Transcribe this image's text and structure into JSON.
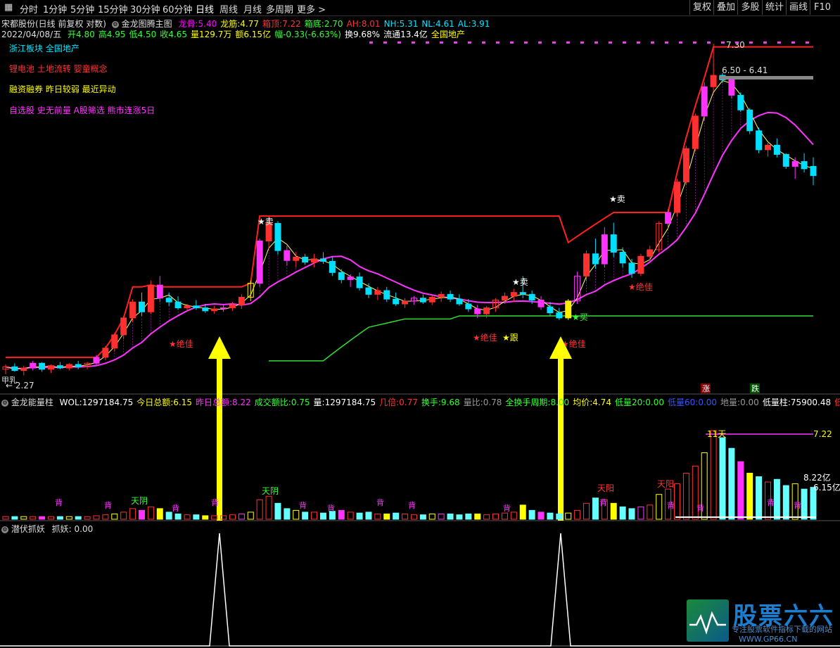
{
  "toolbar": {
    "periods": [
      "分时",
      "1分钟",
      "5分钟",
      "15分钟",
      "30分钟",
      "60分钟",
      "日线",
      "周线",
      "月线",
      "多周期",
      "更多 >"
    ],
    "active": "日线",
    "right_buttons": [
      "复权",
      "叠加",
      "多股",
      "统计",
      "画线",
      "F10"
    ]
  },
  "header": {
    "stock": "宋都股份(日线 前复权 对数)",
    "indicator_name": "金龙图腾主图",
    "stats": [
      {
        "label": "龙骨:",
        "value": "5.40",
        "color": "#ff00ff"
      },
      {
        "label": "龙筋:",
        "value": "4.77",
        "color": "#ffff00"
      },
      {
        "label": "箱顶:",
        "value": "7.22",
        "color": "#ff3333"
      },
      {
        "label": "箱底:",
        "value": "2.70",
        "color": "#33ff33"
      },
      {
        "label": "AH:",
        "value": "8.01",
        "color": "#ff3333"
      },
      {
        "label": "NH:",
        "value": "5.31",
        "color": "#00e5ff"
      },
      {
        "label": "NL:",
        "value": "4.61",
        "color": "#00e5ff"
      },
      {
        "label": "AL:",
        "value": "3.91",
        "color": "#00e5ff"
      }
    ],
    "date": "2022/04/08/五",
    "quote": [
      {
        "label": "开",
        "value": "4.80",
        "color": "#33ff33"
      },
      {
        "label": "高",
        "value": "4.95",
        "color": "#33ff33"
      },
      {
        "label": "低",
        "value": "4.50",
        "color": "#33ff33"
      },
      {
        "label": "收",
        "value": "4.65",
        "color": "#33ff33"
      },
      {
        "label": "量",
        "value": "129.7万",
        "color": "#ffff00"
      },
      {
        "label": "额",
        "value": "6.15亿",
        "color": "#ffff00"
      },
      {
        "label": "幅",
        "value": "-0.33(-6.63%)",
        "color": "#33ff33"
      },
      {
        "label": "换",
        "value": "9.68%",
        "color": "#ffffff"
      },
      {
        "label": "流通",
        "value": "13.4亿",
        "color": "#ffffff"
      },
      {
        "label": "",
        "value": "全国地产",
        "color": "#ffff00"
      }
    ]
  },
  "tags": [
    {
      "text": "浙江板块 全国地产",
      "color": "#00e5ff"
    },
    {
      "text": "锂电池 土地流转 婴童概念",
      "color": "#ff3333"
    },
    {
      "text": "融资融券 昨日较弱 最近异动",
      "color": "#ffff00"
    },
    {
      "text": "自选股 史无前量 A股筛选 熊市连涨5日",
      "color": "#ff33ff"
    }
  ],
  "price_labels": {
    "top": "7.30",
    "range": "6.50 - 6.41",
    "low": "2.27",
    "left_mark": "甲乳"
  },
  "signals": {
    "sell": "★卖",
    "buy": "★买",
    "best": "★绝佳",
    "follow": "★跟"
  },
  "updown": {
    "up": "涨",
    "down": "跌"
  },
  "volume_header": {
    "name": "金龙能量柱",
    "items": [
      {
        "label": "WOL:",
        "value": "1297184.75",
        "color": "#ffffff"
      },
      {
        "label": "今日总额:",
        "value": "6.15",
        "color": "#ffff00"
      },
      {
        "label": "昨日总额:",
        "value": "8.22",
        "color": "#ff33ff"
      },
      {
        "label": "成交额比:",
        "value": "0.75",
        "color": "#33ff33"
      },
      {
        "label": "量:",
        "value": "1297184.75",
        "color": "#ffffff"
      },
      {
        "label": "几倍:",
        "value": "0.77",
        "color": "#ff3333"
      },
      {
        "label": "换手:",
        "value": "9.68",
        "color": "#33ff33"
      },
      {
        "label": "量比:",
        "value": "0.78",
        "color": "#999999"
      },
      {
        "label": "全换手周期:",
        "value": "8.00",
        "color": "#33ff33"
      },
      {
        "label": "均价:",
        "value": "4.74",
        "color": "#ffff00"
      },
      {
        "label": "低量20:",
        "value": "0.00",
        "color": "#33ff33"
      },
      {
        "label": "低量60:",
        "value": "0.00",
        "color": "#3355ff"
      },
      {
        "label": "地量:",
        "value": "0.00",
        "color": "#999999"
      },
      {
        "label": "低量柱:",
        "value": "75900.48",
        "color": "#ffffff"
      },
      {
        "label": "低量柱",
        "value": "",
        "color": "#ff3333"
      }
    ],
    "labels": {
      "days": "11天",
      "top": "7.22",
      "amt1": "8.22亿",
      "amt2": "6.15亿",
      "tianyin": "天阴",
      "tianyang": "天阳",
      "bei": "背"
    }
  },
  "bottom_header": {
    "name": "潜伏抓妖",
    "label": "抓妖:",
    "value": "0.00"
  },
  "watermark": {
    "title": "股票六六",
    "subtitle": "专注股票软件指标下载的网站",
    "url": "WWW.GP66.CN"
  },
  "chart_data": {
    "type": "candlestick",
    "ylim": [
      2.27,
      7.3
    ],
    "candles": [
      [
        2.4,
        2.44,
        2.36,
        2.42
      ],
      [
        2.42,
        2.45,
        2.38,
        2.39
      ],
      [
        2.39,
        2.43,
        2.35,
        2.41
      ],
      [
        2.41,
        2.47,
        2.39,
        2.45
      ],
      [
        2.45,
        2.46,
        2.38,
        2.4
      ],
      [
        2.4,
        2.44,
        2.37,
        2.43
      ],
      [
        2.43,
        2.46,
        2.4,
        2.41
      ],
      [
        2.41,
        2.45,
        2.39,
        2.44
      ],
      [
        2.44,
        2.47,
        2.4,
        2.42
      ],
      [
        2.42,
        2.46,
        2.4,
        2.45
      ],
      [
        2.45,
        2.52,
        2.43,
        2.5
      ],
      [
        2.5,
        2.6,
        2.48,
        2.58
      ],
      [
        2.58,
        2.72,
        2.55,
        2.7
      ],
      [
        2.7,
        2.88,
        2.66,
        2.86
      ],
      [
        2.86,
        3.05,
        2.82,
        3.02
      ],
      [
        3.02,
        3.12,
        2.88,
        2.92
      ],
      [
        2.92,
        3.25,
        2.9,
        3.2
      ],
      [
        3.2,
        3.3,
        3.02,
        3.06
      ],
      [
        3.06,
        3.12,
        2.98,
        3.02
      ],
      [
        3.02,
        3.08,
        2.94,
        2.96
      ],
      [
        2.96,
        3.0,
        2.92,
        2.98
      ],
      [
        2.98,
        3.04,
        2.94,
        2.96
      ],
      [
        2.96,
        3.0,
        2.91,
        2.93
      ],
      [
        2.93,
        2.98,
        2.9,
        2.95
      ],
      [
        2.95,
        3.0,
        2.92,
        2.96
      ],
      [
        2.96,
        3.02,
        2.93,
        2.99
      ],
      [
        2.99,
        3.1,
        2.95,
        3.07
      ],
      [
        3.07,
        3.25,
        3.03,
        3.22
      ],
      [
        3.22,
        3.75,
        3.18,
        3.72
      ],
      [
        3.72,
        4.05,
        3.62,
        3.95
      ],
      [
        3.95,
        3.98,
        3.55,
        3.6
      ],
      [
        3.6,
        3.66,
        3.42,
        3.48
      ],
      [
        3.48,
        3.58,
        3.4,
        3.52
      ],
      [
        3.52,
        3.56,
        3.43,
        3.46
      ],
      [
        3.46,
        3.56,
        3.4,
        3.5
      ],
      [
        3.5,
        3.58,
        3.44,
        3.47
      ],
      [
        3.47,
        3.52,
        3.3,
        3.34
      ],
      [
        3.34,
        3.38,
        3.22,
        3.26
      ],
      [
        3.26,
        3.32,
        3.18,
        3.29
      ],
      [
        3.29,
        3.34,
        3.14,
        3.17
      ],
      [
        3.17,
        3.22,
        3.06,
        3.1
      ],
      [
        3.1,
        3.18,
        3.04,
        3.14
      ],
      [
        3.14,
        3.18,
        3.02,
        3.05
      ],
      [
        3.05,
        3.12,
        2.98,
        3.0
      ],
      [
        3.0,
        3.06,
        2.96,
        3.03
      ],
      [
        3.03,
        3.08,
        2.99,
        3.06
      ],
      [
        3.06,
        3.1,
        3.0,
        3.02
      ],
      [
        3.02,
        3.09,
        2.99,
        3.07
      ],
      [
        3.07,
        3.13,
        3.02,
        3.1
      ],
      [
        3.1,
        3.14,
        3.02,
        3.05
      ],
      [
        3.05,
        3.1,
        2.98,
        3.0
      ],
      [
        3.0,
        3.05,
        2.92,
        2.95
      ],
      [
        2.95,
        2.99,
        2.86,
        2.9
      ],
      [
        2.9,
        2.98,
        2.86,
        2.96
      ],
      [
        2.96,
        3.06,
        2.92,
        3.04
      ],
      [
        3.04,
        3.12,
        3.0,
        3.08
      ],
      [
        3.08,
        3.16,
        3.02,
        3.12
      ],
      [
        3.12,
        3.3,
        3.06,
        3.1
      ],
      [
        3.1,
        3.14,
        3.0,
        3.04
      ],
      [
        3.04,
        3.08,
        2.94,
        2.97
      ],
      [
        2.97,
        3.02,
        2.88,
        2.91
      ],
      [
        2.91,
        2.96,
        2.84,
        2.86
      ],
      [
        2.86,
        3.05,
        2.84,
        3.03
      ],
      [
        3.03,
        3.35,
        3.0,
        3.3
      ],
      [
        3.3,
        3.6,
        3.24,
        3.56
      ],
      [
        3.56,
        3.75,
        3.38,
        3.44
      ],
      [
        3.44,
        3.9,
        3.4,
        3.8
      ],
      [
        3.8,
        3.96,
        3.52,
        3.58
      ],
      [
        3.58,
        3.64,
        3.4,
        3.45
      ],
      [
        3.45,
        3.5,
        3.28,
        3.33
      ],
      [
        3.33,
        3.56,
        3.3,
        3.53
      ],
      [
        3.53,
        3.66,
        3.48,
        3.61
      ],
      [
        3.61,
        3.98,
        3.58,
        3.95
      ],
      [
        3.95,
        4.15,
        3.88,
        4.1
      ],
      [
        4.1,
        4.6,
        4.05,
        4.55
      ],
      [
        4.55,
        5.15,
        4.5,
        5.1
      ],
      [
        5.1,
        5.75,
        5.05,
        5.7
      ],
      [
        5.7,
        6.4,
        5.6,
        6.3
      ],
      [
        6.3,
        7.3,
        6.2,
        6.55
      ],
      [
        6.55,
        6.6,
        6.38,
        6.45
      ],
      [
        6.45,
        6.48,
        6.05,
        6.12
      ],
      [
        6.12,
        6.18,
        5.78,
        5.82
      ],
      [
        5.82,
        5.86,
        5.36,
        5.42
      ],
      [
        5.42,
        5.48,
        5.02,
        5.08
      ],
      [
        5.08,
        5.2,
        4.96,
        5.16
      ],
      [
        5.16,
        5.28,
        4.95,
        5.0
      ],
      [
        5.0,
        5.02,
        4.76,
        4.8
      ],
      [
        4.8,
        4.95,
        4.6,
        4.88
      ],
      [
        4.88,
        5.02,
        4.7,
        4.76
      ],
      [
        4.8,
        4.95,
        4.5,
        4.65
      ]
    ],
    "volume": [
      3,
      3,
      3,
      3,
      3,
      3,
      3,
      3,
      3,
      3,
      4,
      5,
      6,
      8,
      12,
      10,
      14,
      12,
      8,
      6,
      5,
      5,
      4,
      4,
      4,
      5,
      6,
      8,
      22,
      26,
      18,
      12,
      10,
      8,
      8,
      7,
      9,
      10,
      8,
      7,
      8,
      6,
      6,
      7,
      6,
      5,
      5,
      6,
      6,
      6,
      5,
      6,
      6,
      5,
      6,
      7,
      8,
      16,
      10,
      8,
      7,
      6,
      7,
      10,
      18,
      24,
      22,
      18,
      14,
      12,
      14,
      16,
      28,
      34,
      40,
      52,
      60,
      75,
      100,
      92,
      80,
      65,
      52,
      48,
      42,
      45,
      38,
      40,
      34,
      36
    ]
  }
}
